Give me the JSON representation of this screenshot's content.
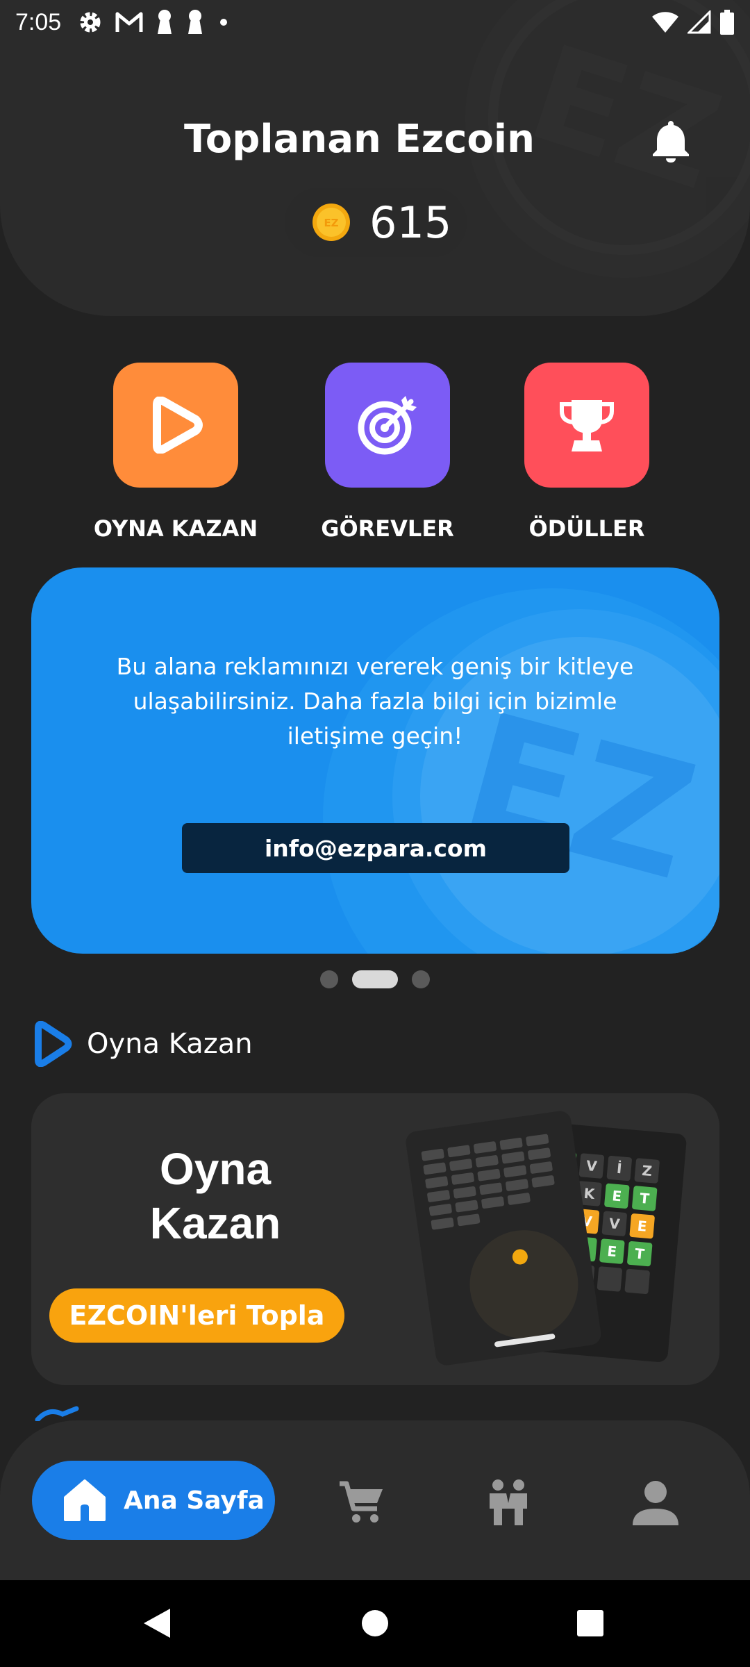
{
  "status_bar": {
    "time": "7:05",
    "left_icons": [
      "settings-icon",
      "gmail-icon",
      "keyhole-icon",
      "keyhole-icon",
      "dot-icon"
    ],
    "right_icons": [
      "wifi-icon",
      "signal-icon",
      "battery-icon"
    ]
  },
  "header": {
    "title": "Toplanan Ezcoin",
    "balance": "615",
    "coin_mark": "EZ"
  },
  "actions": [
    {
      "label": "OYNA KAZAN",
      "icon": "play-icon",
      "color": "#ff8c3a"
    },
    {
      "label": "GÖREVLER",
      "icon": "target-icon",
      "color": "#7c5cf5"
    },
    {
      "label": "ÖDÜLLER",
      "icon": "trophy-icon",
      "color": "#ff4f5a"
    }
  ],
  "banner": {
    "text": "Bu alana reklamınızı vererek geniş bir kitleye ulaşabilirsiniz. Daha fazla bilgi için bizimle iletişime geçin!",
    "button_label": "info@ezpara.com",
    "coin_mark": "EZ"
  },
  "carousel": {
    "count": 3,
    "active_index": 1
  },
  "section": {
    "title": "Oyna Kazan",
    "card_title_line1": "Oyna",
    "card_title_line2": "Kazan",
    "card_button": "EZCOIN'leri Topla",
    "art_letters": [
      "E",
      "V",
      "İ",
      "Z",
      "K",
      "E",
      "T",
      "T",
      "V",
      "E",
      "S",
      "E",
      "T"
    ]
  },
  "bottom_nav": {
    "home_label": "Ana Sayfa",
    "items": [
      "home-icon",
      "cart-icon",
      "people-icon",
      "profile-icon"
    ]
  },
  "colors": {
    "background": "#222222",
    "accent_blue": "#1a7ee8",
    "banner_blue": "#1a8fee",
    "orange": "#f9a30e"
  }
}
